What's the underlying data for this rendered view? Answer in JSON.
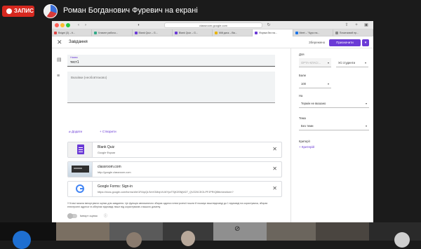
{
  "meeting": {
    "record_label": "ЗАПИС",
    "presenter_text": "Роман Богданович Фуревич на екрані"
  },
  "browser": {
    "url": "classroom.google.com",
    "tabs": [
      {
        "label": "Вхідні (3) – ti..."
      },
      {
        "label": "Класне рабочо..."
      },
      {
        "label": "Blank Quiz – G..."
      },
      {
        "label": "Blank Quiz – G..."
      },
      {
        "label": "Мій диск – Вік..."
      },
      {
        "label": "Форма без на..."
      },
      {
        "label": "Meet – \"Курс на..."
      },
      {
        "label": "Початковий пр..."
      }
    ]
  },
  "header": {
    "title": "Завдання",
    "save_label": "Збережено",
    "assign_label": "Призначити",
    "dropdown_glyph": "▾",
    "close_glyph": "✕"
  },
  "form": {
    "title_label": "Назва",
    "title_value": "тест1",
    "description_placeholder": "Вказівки (необов'язково)",
    "add_label": "Додати",
    "create_label": "Створити",
    "attachments": [
      {
        "title": "Blank Quiz",
        "subtitle": "Google Форми",
        "icon": "forms-icon"
      },
      {
        "title": "classroom.com",
        "subtitle": "http://google.classroom.com",
        "icon": "link-thumbnail"
      },
      {
        "title": "Google Forms: Sign-in",
        "subtitle": "https://docs.google.com/forms/d/e/1FAIpQLSeVGMepVLWYpvTSjK3SNjW27_QVZ20CEOLPFJPRIQBtb/viewform?",
        "icon": "google-g-icon"
      }
    ],
    "notice": "У Класі можна імпортувати оцінки для завдання. Це функція автоматично збирає адреси електронної пошти й показує ваші відповіді до 1 відповіді на користувача, збирає електронні адреси та зберігає відповіді лише від користувачів з вашого домену.",
    "import_label": "Імпорт оцінок"
  },
  "sidebar": {
    "for_label": "Для",
    "class_value": "OPTA-КЛАСІ...",
    "students_value": "Усі студенти",
    "points_label": "Бали",
    "points_value": "100",
    "due_label": "На",
    "due_value": "Термін не вказано",
    "topic_label": "Тема",
    "topic_value": "Без теми",
    "criteria_label": "Критерії",
    "criteria_button": "Критерій"
  },
  "colors": {
    "accent": "#6b3bd6",
    "record": "#d6281f"
  }
}
